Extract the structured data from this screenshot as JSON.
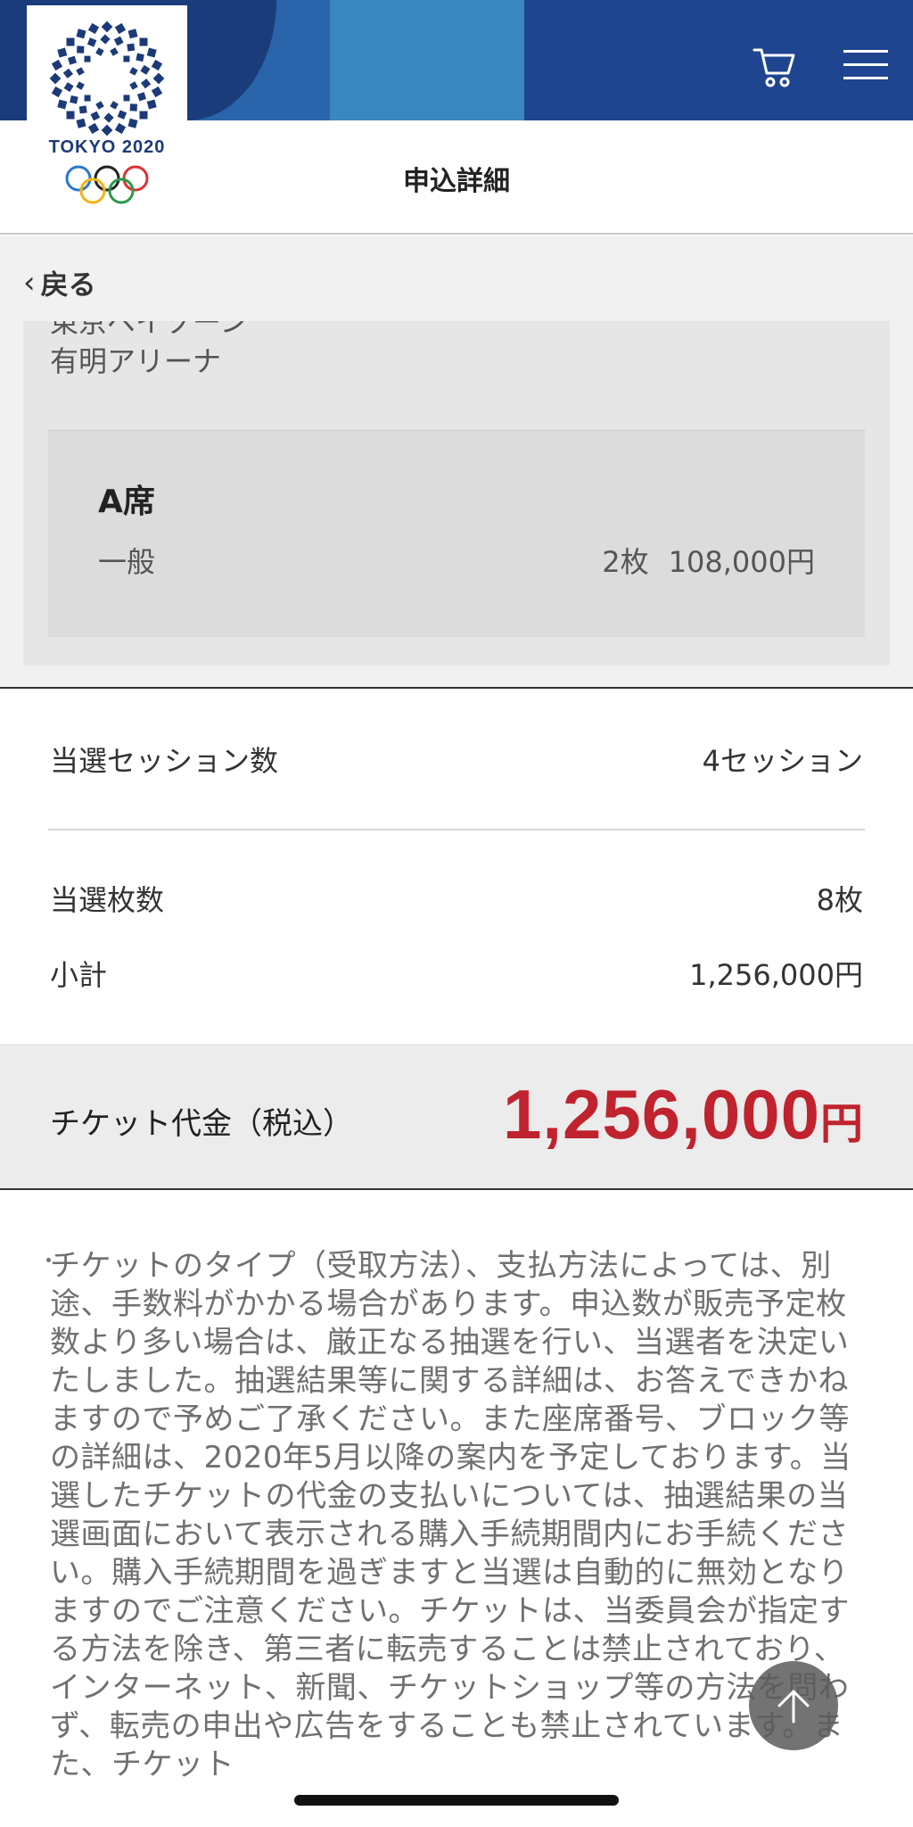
{
  "header": {
    "logo_text": "TOKYO 2020",
    "title": "申込詳細",
    "cart_icon": "cart-icon",
    "menu_icon": "hamburger-menu-icon"
  },
  "nav": {
    "back_label": "戻る"
  },
  "venue": {
    "line1_partial": "東京ベイゾーン",
    "line2": "有明アリーナ"
  },
  "seat": {
    "name": "A席",
    "type": "一般",
    "count": "2枚",
    "price": "108,000円"
  },
  "summary": {
    "sessions_label": "当選セッション数",
    "sessions_value": "4セッション",
    "tickets_label": "当選枚数",
    "tickets_value": "8枚",
    "subtotal_label": "小計",
    "subtotal_value": "1,256,000円"
  },
  "total": {
    "label": "チケット代金（税込）",
    "amount": "1,256,000",
    "unit": "円"
  },
  "notes": {
    "text": "チケットのタイプ（受取方法）、支払方法によっては、別途、手数料がかかる場合があります。申込数が販売予定枚数より多い場合は、厳正なる抽選を行い、当選者を決定いたしました。抽選結果等に関する詳細は、お答えできかねますので予めご了承ください。また座席番号、ブロック等の詳細は、2020年5月以降の案内を予定しております。当選したチケットの代金の支払いについては、抽選結果の当選画面において表示される購入手続期間内にお手続ください。購入手続期間を過ぎますと当選は自動的に無効となりますのでご注意ください。チケットは、当委員会が指定する方法を除き、第三者に転売することは禁止されており、インターネット、新聞、チケットショップ等の方法を問わず、転売の申出や広告をすることも禁止されています。また、チケット"
  },
  "colors": {
    "banner_dark": "#1b3c7a",
    "banner_mid": "#2a64aa",
    "banner_light": "#3a86bf",
    "total_red": "#c0232e"
  }
}
